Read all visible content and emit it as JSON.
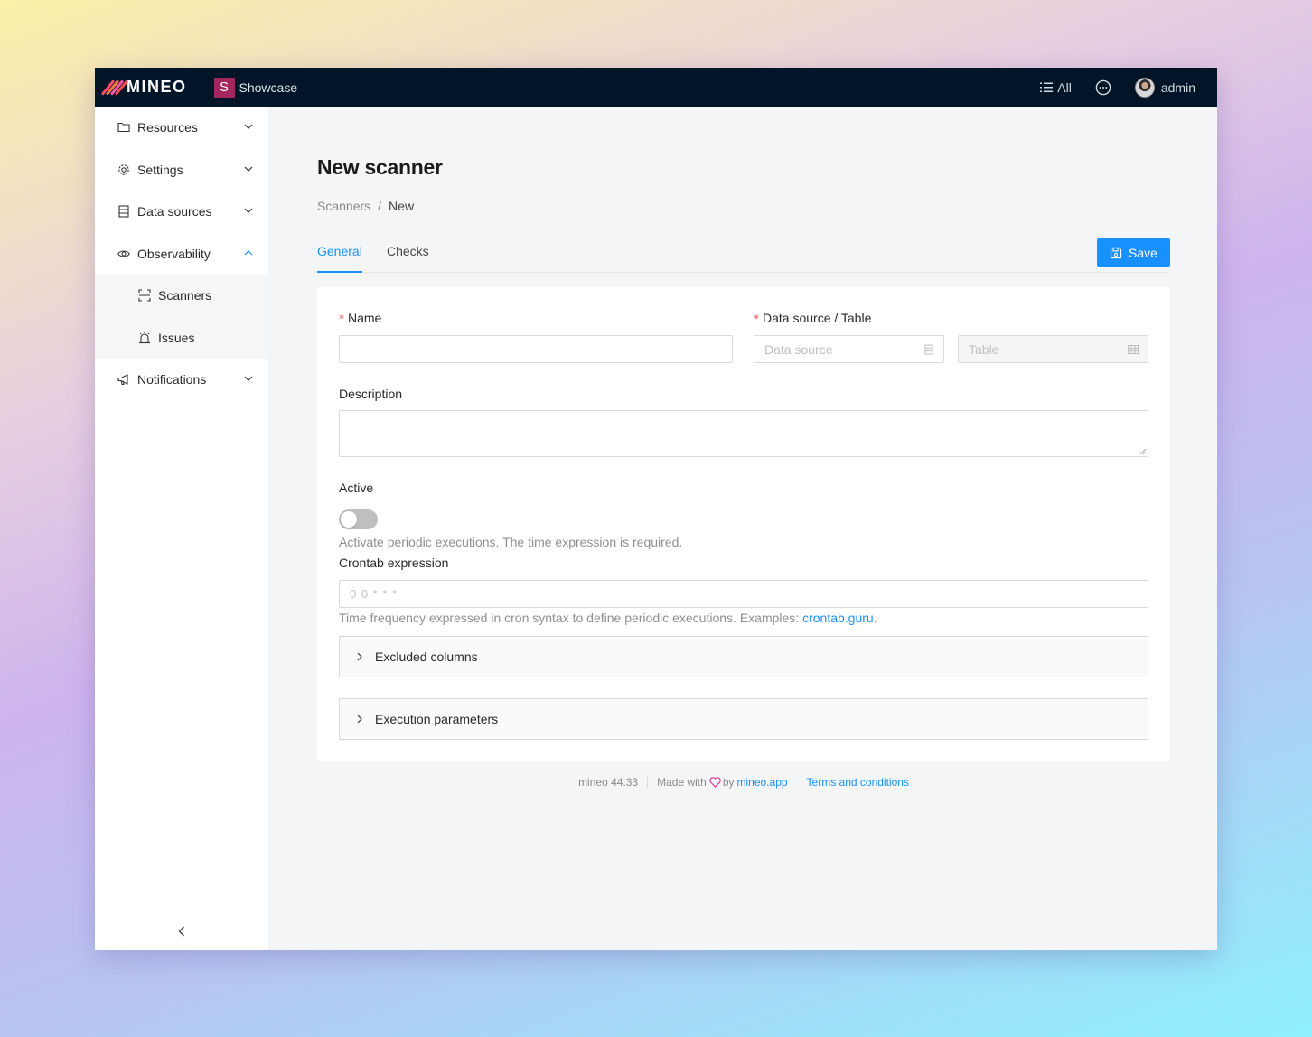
{
  "topbar": {
    "brand": "MINEO",
    "workspace_badge": "S",
    "workspace_name": "Showcase",
    "filter_label": "All",
    "user_name": "admin"
  },
  "sidebar": {
    "items": [
      {
        "label": "Resources",
        "icon": "folder-icon",
        "expanded": false
      },
      {
        "label": "Settings",
        "icon": "gear-icon",
        "expanded": false
      },
      {
        "label": "Data sources",
        "icon": "database-icon",
        "expanded": false
      },
      {
        "label": "Observability",
        "icon": "eye-icon",
        "expanded": true
      },
      {
        "label": "Notifications",
        "icon": "megaphone-icon",
        "expanded": false
      }
    ],
    "sub_items": [
      {
        "label": "Scanners",
        "icon": "scan-icon"
      },
      {
        "label": "Issues",
        "icon": "alarm-icon"
      }
    ]
  },
  "page": {
    "title": "New scanner",
    "breadcrumb": [
      "Scanners",
      "New"
    ],
    "breadcrumb_sep": "/",
    "tabs": [
      "General",
      "Checks"
    ],
    "active_tab": "General",
    "save_label": "Save"
  },
  "form": {
    "name_label": "Name",
    "name_value": "",
    "datasource_label": "Data source / Table",
    "datasource_placeholder": "Data source",
    "table_placeholder": "Table",
    "description_label": "Description",
    "description_value": "",
    "active_label": "Active",
    "active_on": false,
    "active_help": "Activate periodic executions. The time expression is required.",
    "crontab_label": "Crontab expression",
    "crontab_placeholder": "0 0 * * *",
    "crontab_help": "Time frequency expressed in cron syntax to define periodic executions. Examples: ",
    "crontab_help_link": "crontab.guru",
    "crontab_help_end": ".",
    "excluded_columns_label": "Excluded columns",
    "execution_parameters_label": "Execution parameters",
    "required_mark": "*"
  },
  "footer": {
    "version": "mineo 44.33",
    "made_with": "Made with",
    "by": "by",
    "site_link": "mineo.app",
    "terms_link": "Terms and conditions"
  },
  "colors": {
    "topbar": "#001528",
    "accent": "#1890ff",
    "workspace_badge": "#a5265e",
    "heart": "#eb2f96"
  }
}
